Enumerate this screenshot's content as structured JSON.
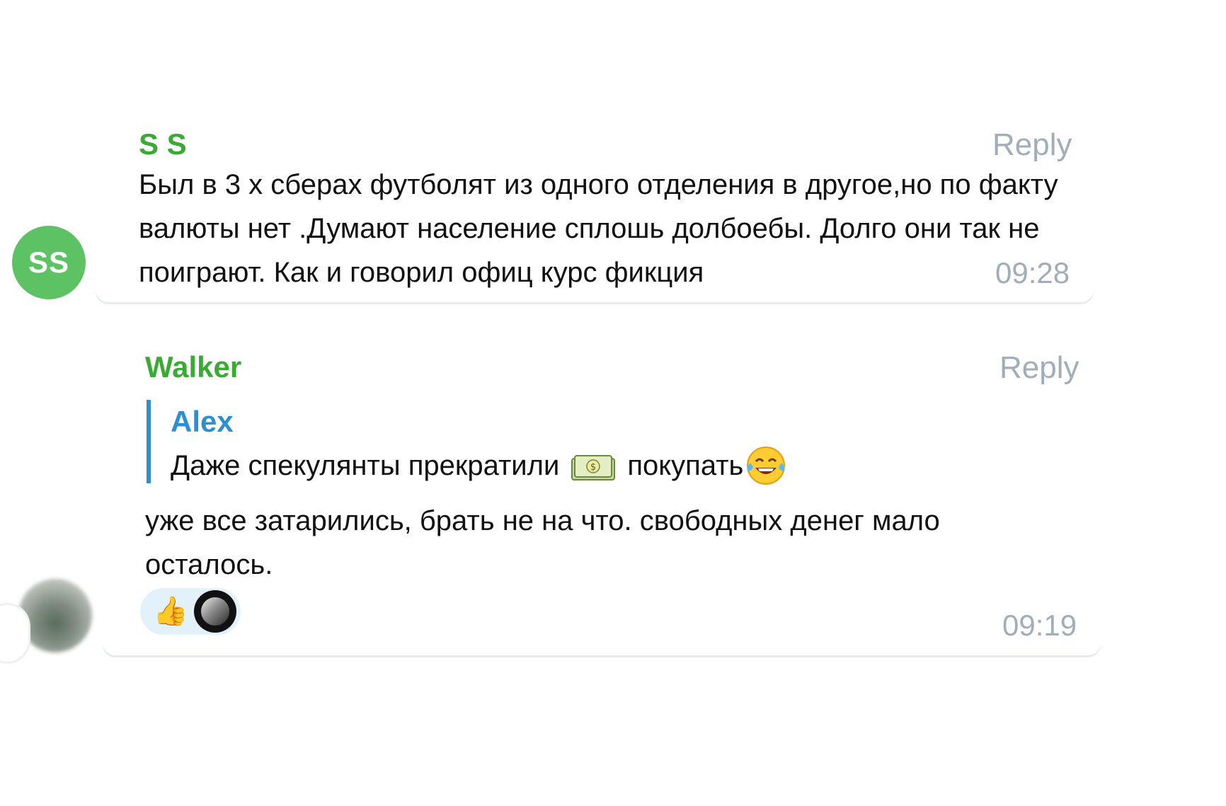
{
  "messages": [
    {
      "avatar_initials": "SS",
      "avatar_color": "#5dc264",
      "sender": "S S",
      "reply_label": "Reply",
      "text": "Был в 3 х сберах футболят из одного отделения в другое,но по факту валюты нет .Думают население сплошь долбоебы. Долго они так не поиграют. Как и говорил офиц курс фикция",
      "time": "09:28"
    },
    {
      "avatar_kind": "photo",
      "sender": "Walker",
      "reply_label": "Reply",
      "quote": {
        "author": "Alex",
        "text_before": "Даже спекулянты прекратили",
        "icon_money": "money-banknote-icon",
        "text_after": "покупать",
        "icon_laugh": "tears-of-joy-icon"
      },
      "text": "уже все затарились, брать не на что. свободных денег мало осталось.",
      "reaction": {
        "emoji": "👍",
        "icon": "thumbs-up-icon"
      },
      "time": "09:19"
    }
  ],
  "colors": {
    "sender_name": "#3aaa35",
    "quote_accent": "#2e8fd0",
    "meta_text": "#a1adb8",
    "reaction_bg": "#e3f1fb"
  }
}
